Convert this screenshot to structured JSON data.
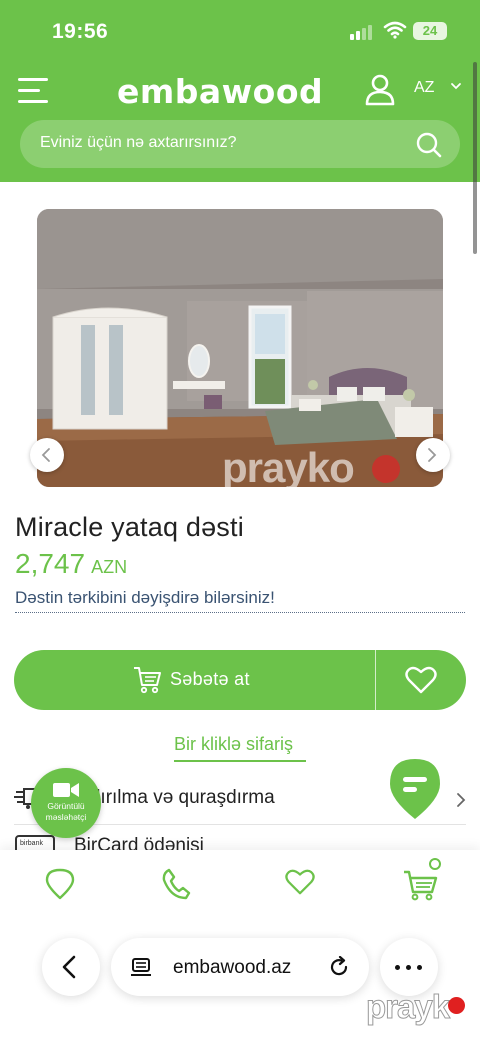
{
  "status_bar": {
    "time": "19:56",
    "battery": "24"
  },
  "header": {
    "logo": "embawood",
    "language": "AZ",
    "search_placeholder": "Eviniz üçün nə axtarırsınız?"
  },
  "gallery": {
    "watermark": "prayko"
  },
  "product": {
    "title": "Miracle yataq dəsti",
    "price": "2,747",
    "currency": "AZN",
    "note": "Dəstin tərkibini dəyişdirə bilərsiniz!"
  },
  "actions": {
    "add_to_cart": "Səbətə at",
    "one_click_order": "Bir kliklə sifariş"
  },
  "rows": [
    {
      "label": "atdırılma və quraşdırma"
    },
    {
      "label": "BirCard ödənişi"
    }
  ],
  "video_consult": {
    "label_line1": "Görüntülü",
    "label_line2": "məsləhətçi"
  },
  "bircard_small": "birbank",
  "bottom_nav": [
    "location-icon",
    "phone-icon",
    "heart-icon",
    "cart-icon"
  ],
  "browser": {
    "url": "embawood.az"
  },
  "watermark2": "prayk",
  "colors": {
    "brand_green": "#6cc24a",
    "note_blue": "#3a5372"
  }
}
